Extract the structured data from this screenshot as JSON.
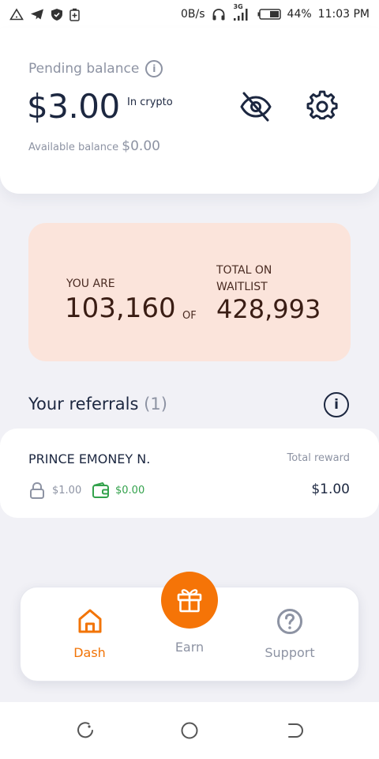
{
  "status_bar": {
    "network_speed": "0B/s",
    "signal_label": "3G",
    "battery": "44%",
    "time": "11:03 PM",
    "icons": [
      "alert-triangle-icon",
      "telegram-icon",
      "shield-icon",
      "battery-saver-icon",
      "headset-icon",
      "signal-icon",
      "battery-icon"
    ]
  },
  "balance_card": {
    "pending_label": "Pending balance",
    "info_glyph": "i",
    "amount": "$3.00",
    "unit_label": "In crypto",
    "available_label": "Available balance",
    "available_amount": "$0.00",
    "icons": [
      "eye-off-icon",
      "gear-icon"
    ]
  },
  "waitlist": {
    "you_are_label": "YOU ARE",
    "position": "103,160",
    "of_label": "OF",
    "total_label": "TOTAL ON WAITLIST",
    "total": "428,993",
    "background_color": "#fbe4db"
  },
  "referrals": {
    "title": "Your referrals",
    "count": "(1)",
    "info_glyph": "i",
    "items": [
      {
        "name": "PRINCE EMONEY N.",
        "locked_amount": "$1.00",
        "wallet_amount": "$0.00",
        "total_reward_label": "Total reward",
        "total_reward": "$1.00"
      }
    ]
  },
  "bottom_nav": {
    "items": [
      {
        "label": "Dash",
        "icon": "home-icon",
        "active": true
      },
      {
        "label": "Earn",
        "icon": "gift-icon",
        "active": false
      },
      {
        "label": "Support",
        "icon": "help-circle-icon",
        "active": false
      }
    ],
    "accent_color": "#f57407"
  },
  "system_nav": {
    "icons": [
      "recents-icon",
      "home-circle-icon",
      "back-icon"
    ]
  }
}
